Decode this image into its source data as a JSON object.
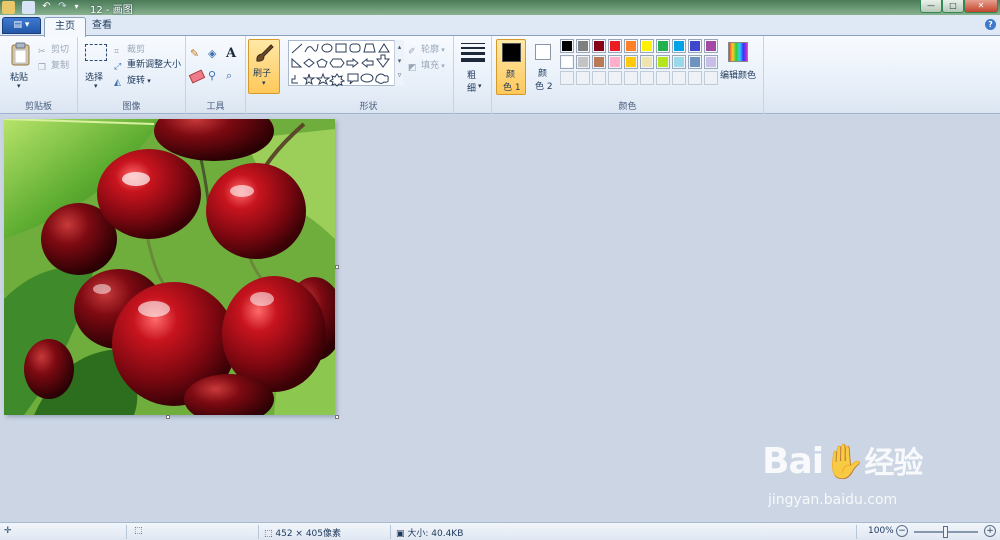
{
  "window": {
    "title": "12 - 画图"
  },
  "tabs": [
    {
      "label": "主页"
    },
    {
      "label": "查看"
    }
  ],
  "ribbon": {
    "clipboard": {
      "paste": "粘贴",
      "cut": "剪切",
      "copy": "复制",
      "label": "剪贴板"
    },
    "image": {
      "select": "选择",
      "crop": "裁剪",
      "resize": "重新调整大小",
      "rotate": "旋转",
      "label": "图像"
    },
    "tools": {
      "label": "工具",
      "text_glyph": "A"
    },
    "brushes": {
      "label": "刷子"
    },
    "shapes": {
      "outline": "轮廓",
      "fill": "填充",
      "label": "形状"
    },
    "size": {
      "label_top": "粗",
      "label_bottom": "细"
    },
    "colors": {
      "color1_top": "颜",
      "color1_bottom": "色 1",
      "color2_top": "颜",
      "color2_bottom": "色 2",
      "edit": "编辑颜色",
      "label": "颜色",
      "color1": "#000000",
      "color2": "#ffffff",
      "palette_row1": [
        "#000000",
        "#7f7f7f",
        "#880015",
        "#ed1c24",
        "#ff7f27",
        "#fff200",
        "#22b14c",
        "#00a2e8",
        "#3f48cc",
        "#a349a4"
      ],
      "palette_row2": [
        "#ffffff",
        "#c3c3c3",
        "#b97a57",
        "#ffaec9",
        "#ffc90e",
        "#efe4b0",
        "#b5e61d",
        "#99d9ea",
        "#7092be",
        "#c8bfe7"
      ]
    }
  },
  "status": {
    "dimensions": "452 × 405像素",
    "file_size": "大小: 40.4KB",
    "zoom": "100%",
    "zoom_fraction": 0.5
  },
  "watermark": {
    "brand": "Bai",
    "brand_cn": "经验",
    "url": "jingyan.baidu.com"
  }
}
